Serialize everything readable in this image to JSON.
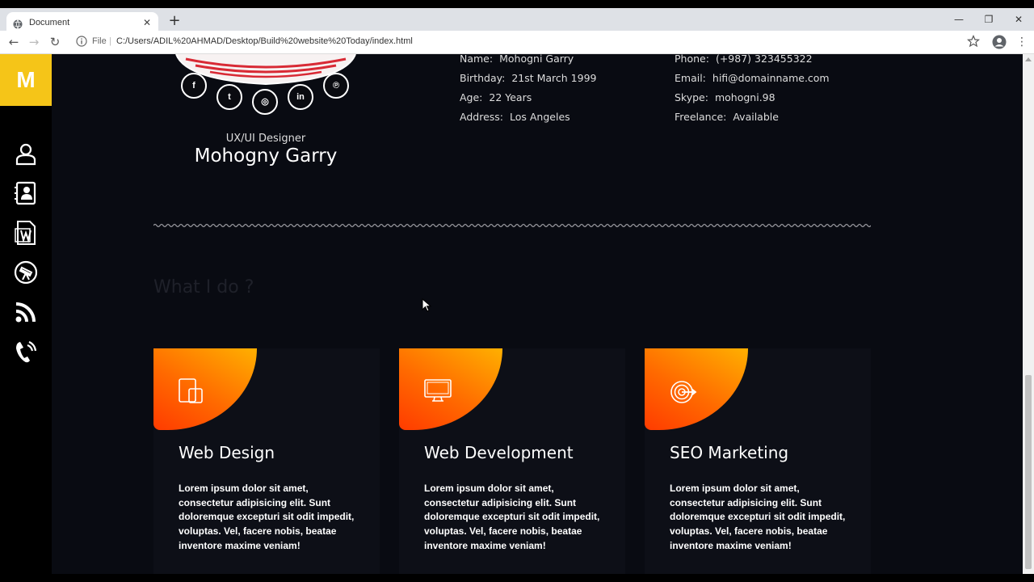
{
  "browser": {
    "tab_title": "Document",
    "tab_close": "✕",
    "new_tab": "+",
    "file_label": "File",
    "url": "C:/Users/ADIL%20AHMAD/Desktop/Build%20website%20Today/index.html",
    "window": {
      "minimize": "—",
      "restore": "❐",
      "close": "✕"
    }
  },
  "sidebar": {
    "logo": "M",
    "icons": [
      "user-icon",
      "contact-card-icon",
      "document-icon",
      "telescope-icon",
      "rss-icon",
      "phone-icon"
    ],
    "logo_color": "#f5c518"
  },
  "profile": {
    "role": "UX/UI Designer",
    "name": "Mohogny Garry",
    "social": [
      {
        "icon": "facebook-icon",
        "glyph": "f"
      },
      {
        "icon": "twitter-icon",
        "glyph": "t"
      },
      {
        "icon": "instagram-icon",
        "glyph": "◎"
      },
      {
        "icon": "linkedin-icon",
        "glyph": "in"
      },
      {
        "icon": "pinterest-icon",
        "glyph": "℗"
      }
    ]
  },
  "info_left": [
    {
      "key": "Name:",
      "value": "Mohogni Garry"
    },
    {
      "key": "Birthday:",
      "value": "21st March 1999"
    },
    {
      "key": "Age:",
      "value": "22 Years"
    },
    {
      "key": "Address:",
      "value": "Los Angeles"
    }
  ],
  "info_right": [
    {
      "key": "Phone:",
      "value": "(+987) 323455322"
    },
    {
      "key": "Email:",
      "value": "hifi@domainname.com"
    },
    {
      "key": "Skype:",
      "value": "mohogni.98"
    },
    {
      "key": "Freelance:",
      "value": "Available"
    }
  ],
  "services": {
    "title": "What I do ?",
    "cards": [
      {
        "icon": "devices-icon",
        "title": "Web Design",
        "text": "Lorem ipsum dolor sit amet, consectetur adipisicing elit. Sunt doloremque excepturi sit odit impedit, voluptas. Vel, facere nobis, beatae inventore maxime veniam!"
      },
      {
        "icon": "monitor-icon",
        "title": "Web Development",
        "text": "Lorem ipsum dolor sit amet, consectetur adipisicing elit. Sunt doloremque excepturi sit odit impedit, voluptas. Vel, facere nobis, beatae inventore maxime veniam!"
      },
      {
        "icon": "target-icon",
        "title": "SEO Marketing",
        "text": "Lorem ipsum dolor sit amet, consectetur adipisicing elit. Sunt doloremque excepturi sit odit impedit, voluptas. Vel, facere nobis, beatae inventore maxime veniam!"
      }
    ]
  },
  "colors": {
    "accent_gradient_start": "#ff3b00",
    "accent_gradient_end": "#ffb000",
    "background": "#090b12"
  }
}
